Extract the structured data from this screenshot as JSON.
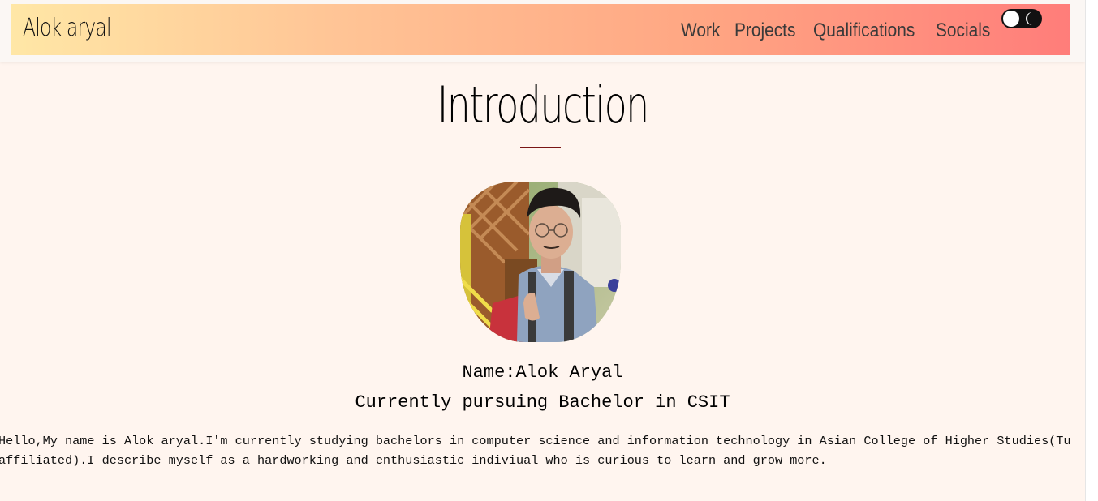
{
  "navbar": {
    "brand": "Alok aryal",
    "links": [
      {
        "label": "Work"
      },
      {
        "label": "Projects"
      },
      {
        "label": "Qualifications"
      },
      {
        "label": "Socials"
      }
    ],
    "theme_toggle": {
      "state": "light",
      "icon": "moon-icon"
    },
    "gradient_colors": [
      "#ffe7a6",
      "#ffc596",
      "#ffa683",
      "#ff7d7a"
    ]
  },
  "intro": {
    "title": "Introduction",
    "divider_color": "#7a1616",
    "name": "Name:Alok Aryal",
    "degree": "Currently pursuing Bachelor in CSIT",
    "bio": "Hello,My name is Alok aryal.I'm currently studying bachelors in computer science and information technology in Asian College of Higher Studies(Tu affiliated).I describe myself as a hardworking and enthusiastic indiviual who is curious to learn and grow more."
  },
  "background_color": "#fff5ef"
}
